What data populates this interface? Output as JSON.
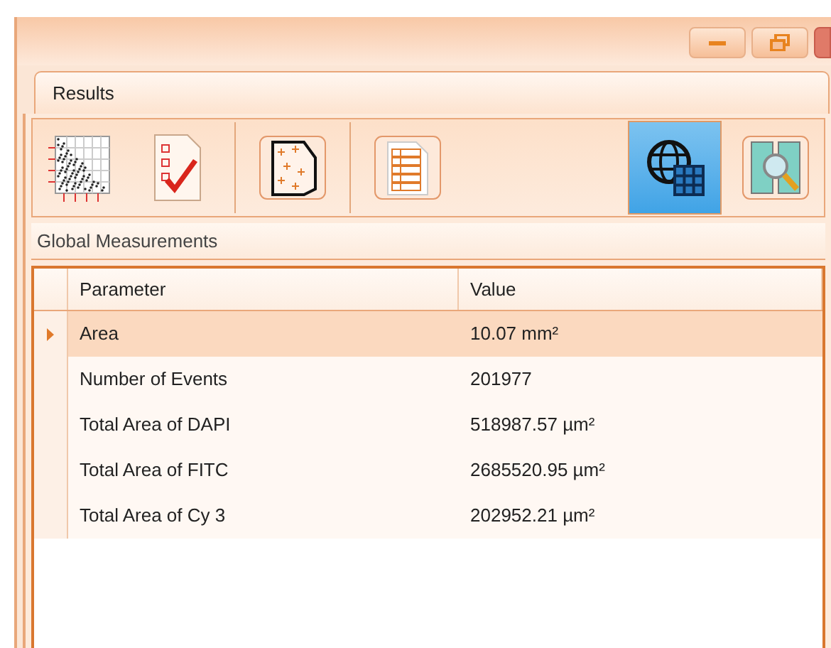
{
  "window": {
    "controls": [
      {
        "kind": "minimize"
      },
      {
        "kind": "restore"
      },
      {
        "kind": "close"
      }
    ]
  },
  "tabs": [
    {
      "label": "Results",
      "selected": true
    }
  ],
  "toolbar": [
    {
      "kind": "scatter",
      "selected": false
    },
    {
      "kind": "checklist",
      "selected": false
    },
    {
      "kind": "gate",
      "selected": false
    },
    {
      "kind": "table",
      "selected": false
    },
    {
      "kind": "globe-grid",
      "selected": true
    },
    {
      "kind": "zoom-image",
      "selected": false
    }
  ],
  "panel": {
    "title": "Global Measurements"
  },
  "table": {
    "columns": [
      "Parameter",
      "Value"
    ],
    "rows": [
      {
        "parameter": "Area",
        "value": "10.07 mm²",
        "selected": true
      },
      {
        "parameter": "Number of Events",
        "value": "201977",
        "selected": false
      },
      {
        "parameter": "Total Area of DAPI",
        "value": "518987.57 µm²",
        "selected": false
      },
      {
        "parameter": "Total Area of FITC",
        "value": "2685520.95 µm²",
        "selected": false
      },
      {
        "parameter": "Total Area of Cy 3",
        "value": "202952.21 µm²",
        "selected": false
      }
    ]
  }
}
